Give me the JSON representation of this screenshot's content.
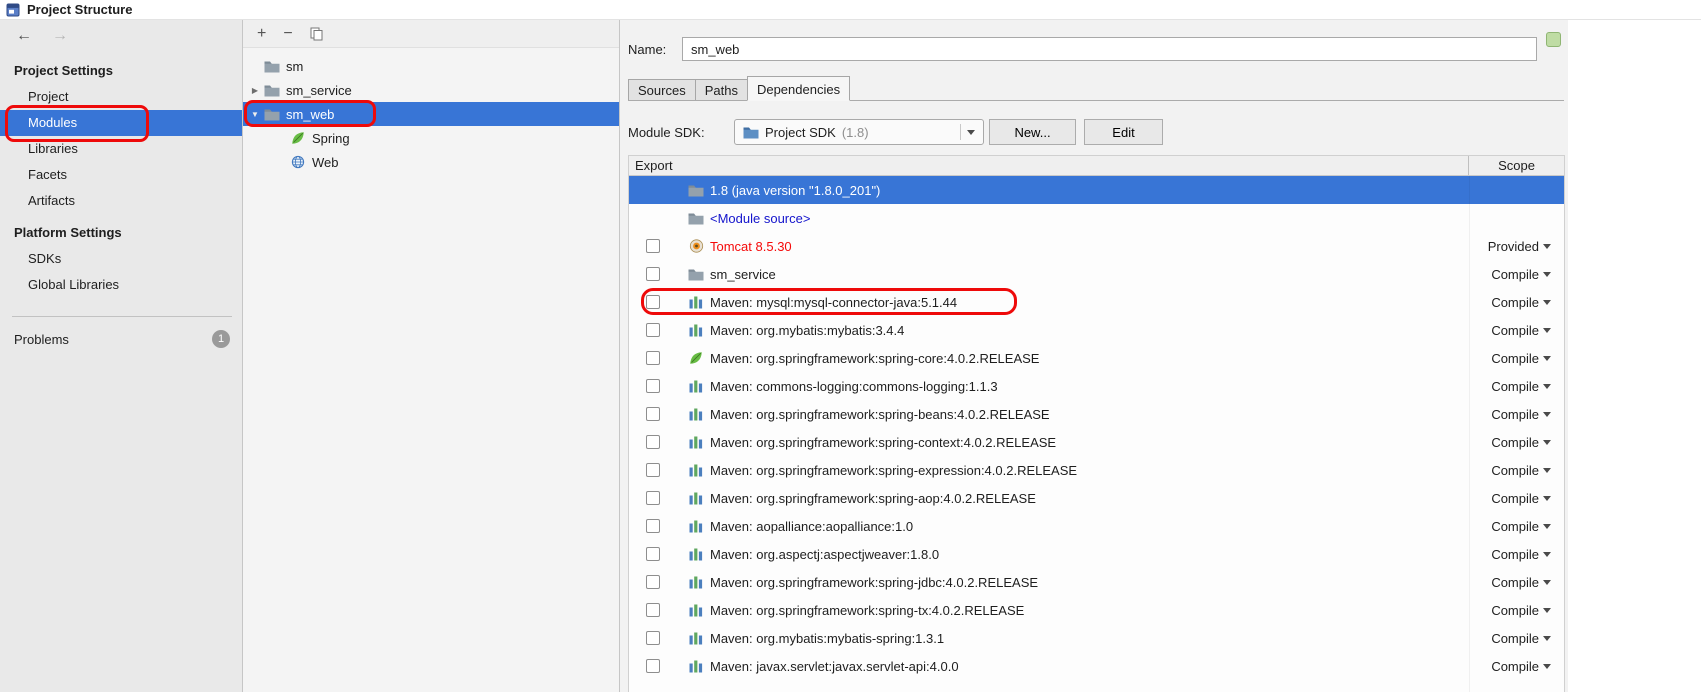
{
  "window": {
    "title": "Project Structure"
  },
  "nav": {
    "back": "←",
    "forward": "→"
  },
  "sidebar": {
    "sections": [
      {
        "header": "Project Settings",
        "items": [
          {
            "label": "Project"
          },
          {
            "label": "Modules",
            "selected": true,
            "annotated": true
          },
          {
            "label": "Libraries"
          },
          {
            "label": "Facets"
          },
          {
            "label": "Artifacts"
          }
        ]
      },
      {
        "header": "Platform Settings",
        "items": [
          {
            "label": "SDKs"
          },
          {
            "label": "Global Libraries"
          }
        ]
      }
    ],
    "problems": {
      "label": "Problems",
      "badge": "1"
    }
  },
  "module_tree": {
    "add_glyph": "+",
    "remove_glyph": "−",
    "items": [
      {
        "label": "sm",
        "icon": "folder",
        "indent": 0,
        "chevron": "none"
      },
      {
        "label": "sm_service",
        "icon": "folder",
        "indent": 0,
        "chevron": "collapsed"
      },
      {
        "label": "sm_web",
        "icon": "folder",
        "indent": 0,
        "chevron": "expanded",
        "selected": true,
        "annotated": true
      },
      {
        "label": "Spring",
        "icon": "spring",
        "indent": 1,
        "chevron": "none"
      },
      {
        "label": "Web",
        "icon": "web",
        "indent": 1,
        "chevron": "none"
      }
    ]
  },
  "editor": {
    "name_label": "Name:",
    "name_value": "sm_web",
    "tabs": [
      {
        "label": "Sources",
        "selected": false
      },
      {
        "label": "Paths",
        "selected": false
      },
      {
        "label": "Dependencies",
        "selected": true
      }
    ],
    "sdk": {
      "label": "Module SDK:",
      "value": "Project SDK",
      "version": "(1.8)",
      "new_button": "New...",
      "edit_button": "Edit"
    },
    "dependencies": {
      "headers": {
        "export": "Export",
        "scope": "Scope"
      },
      "rows": [
        {
          "label": "1.8 (java version \"1.8.0_201\")",
          "icon": "folder",
          "checkbox": false,
          "scope": "",
          "selected": true
        },
        {
          "label": "<Module source>",
          "icon": "folder",
          "checkbox": false,
          "scope": "",
          "link": true
        },
        {
          "label": "Tomcat 8.5.30",
          "icon": "tomcat",
          "checkbox": true,
          "scope": "Provided",
          "red": true
        },
        {
          "label": "sm_service",
          "icon": "folder",
          "checkbox": true,
          "scope": "Compile"
        },
        {
          "label": "Maven: mysql:mysql-connector-java:5.1.44",
          "icon": "library",
          "checkbox": true,
          "scope": "Compile",
          "annotated": true
        },
        {
          "label": "Maven: org.mybatis:mybatis:3.4.4",
          "icon": "library",
          "checkbox": true,
          "scope": "Compile"
        },
        {
          "label": "Maven: org.springframework:spring-core:4.0.2.RELEASE",
          "icon": "spring",
          "checkbox": true,
          "scope": "Compile"
        },
        {
          "label": "Maven: commons-logging:commons-logging:1.1.3",
          "icon": "library",
          "checkbox": true,
          "scope": "Compile"
        },
        {
          "label": "Maven: org.springframework:spring-beans:4.0.2.RELEASE",
          "icon": "library",
          "checkbox": true,
          "scope": "Compile"
        },
        {
          "label": "Maven: org.springframework:spring-context:4.0.2.RELEASE",
          "icon": "library",
          "checkbox": true,
          "scope": "Compile"
        },
        {
          "label": "Maven: org.springframework:spring-expression:4.0.2.RELEASE",
          "icon": "library",
          "checkbox": true,
          "scope": "Compile"
        },
        {
          "label": "Maven: org.springframework:spring-aop:4.0.2.RELEASE",
          "icon": "library",
          "checkbox": true,
          "scope": "Compile"
        },
        {
          "label": "Maven: aopalliance:aopalliance:1.0",
          "icon": "library",
          "checkbox": true,
          "scope": "Compile"
        },
        {
          "label": "Maven: org.aspectj:aspectjweaver:1.8.0",
          "icon": "library",
          "checkbox": true,
          "scope": "Compile"
        },
        {
          "label": "Maven: org.springframework:spring-jdbc:4.0.2.RELEASE",
          "icon": "library",
          "checkbox": true,
          "scope": "Compile"
        },
        {
          "label": "Maven: org.springframework:spring-tx:4.0.2.RELEASE",
          "icon": "library",
          "checkbox": true,
          "scope": "Compile"
        },
        {
          "label": "Maven: org.mybatis:mybatis-spring:1.3.1",
          "icon": "library",
          "checkbox": true,
          "scope": "Compile"
        },
        {
          "label": "Maven: javax.servlet:javax.servlet-api:4.0.0",
          "icon": "library",
          "checkbox": true,
          "scope": "Compile"
        }
      ]
    }
  },
  "colors": {
    "selection_blue": "#3875D6",
    "annotation_red": "#EE0A0A",
    "link_blue": "#1414CC",
    "error_red": "#F50A0A",
    "spring_green": "#68BD45"
  }
}
